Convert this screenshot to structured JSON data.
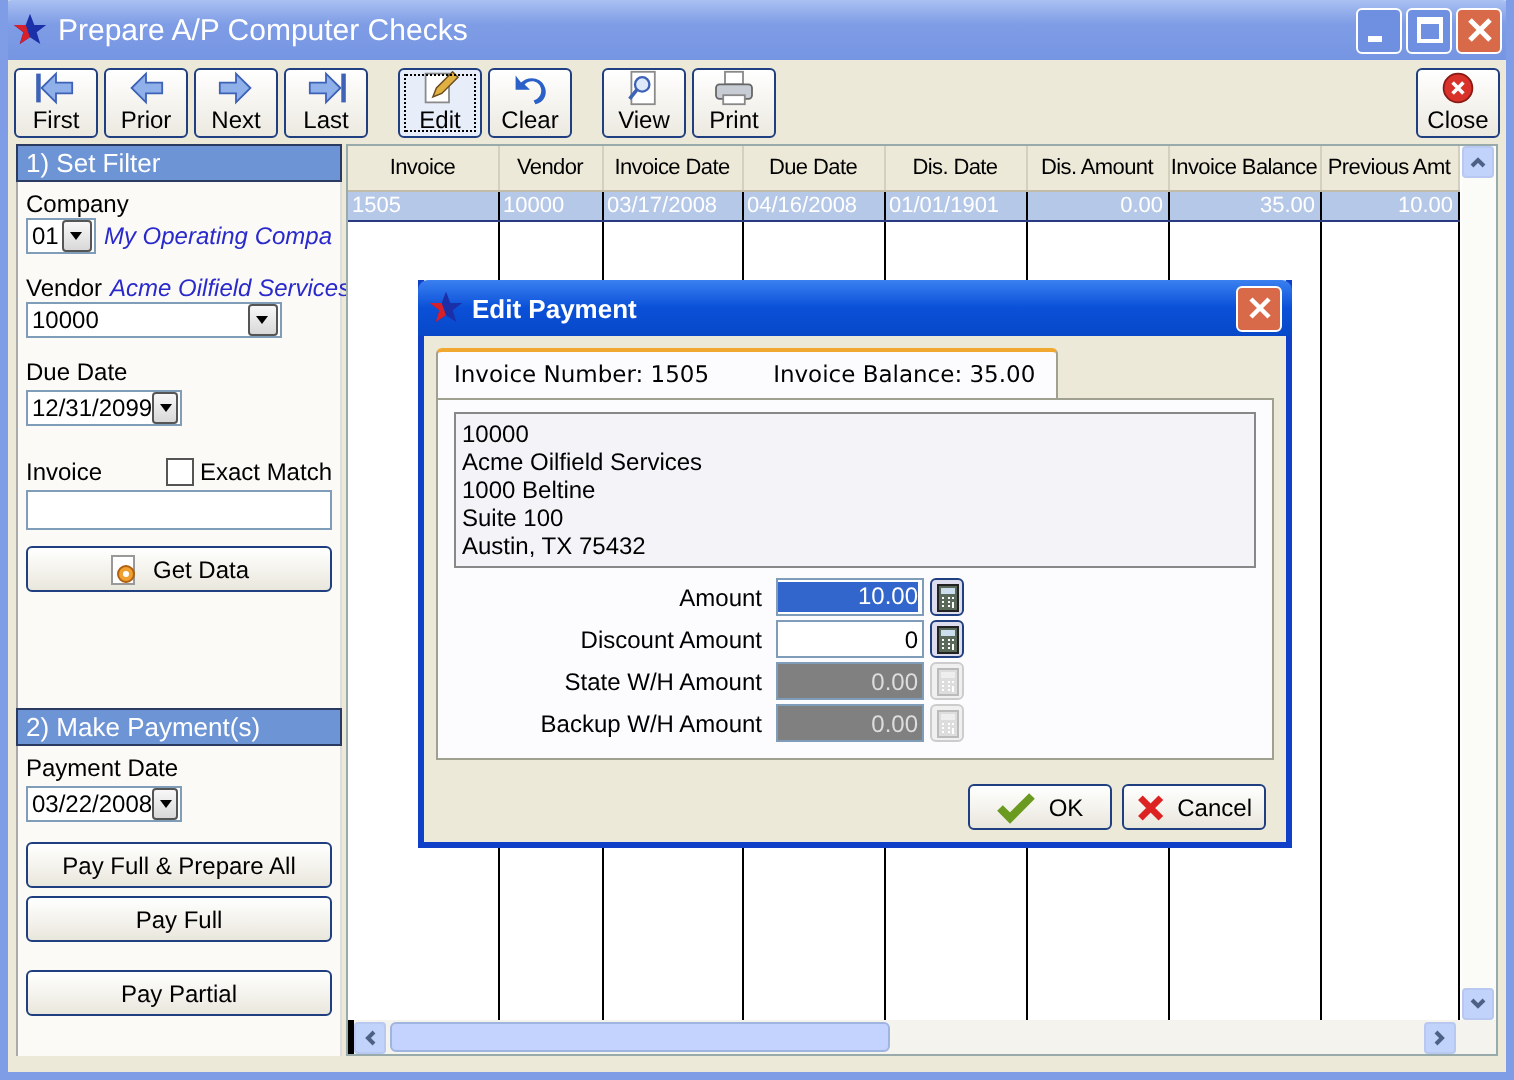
{
  "window": {
    "title": "Prepare A/P Computer Checks"
  },
  "toolbar": {
    "buttons": [
      {
        "label": "First",
        "kind": "first",
        "focused": false
      },
      {
        "label": "Prior",
        "kind": "prior",
        "focused": false
      },
      {
        "label": "Next",
        "kind": "next",
        "focused": false
      },
      {
        "label": "Last",
        "kind": "last",
        "focused": false
      },
      {
        "label": "Edit",
        "kind": "edit",
        "focused": true
      },
      {
        "label": "Clear",
        "kind": "clear",
        "focused": false
      },
      {
        "label": "View",
        "kind": "view",
        "focused": false
      },
      {
        "label": "Print",
        "kind": "print",
        "focused": false
      }
    ],
    "close": {
      "label": "Close"
    }
  },
  "filter": {
    "heading": "1) Set Filter",
    "company_label": "Company",
    "company_value": "01",
    "company_name": "My Operating Compa",
    "vendor_label": "Vendor",
    "vendor_name": "Acme Oilfield Services",
    "vendor_value": "10000",
    "due_date_label": "Due Date",
    "due_date_value": "12/31/2099",
    "invoice_label": "Invoice",
    "exact_match": {
      "label": "Exact Match",
      "checked": false
    },
    "get_data": "Get Data"
  },
  "payment": {
    "heading": "2) Make Payment(s)",
    "date_label": "Payment Date",
    "date_value": "03/22/2008",
    "buttons": [
      "Pay Full & Prepare All",
      "Pay Full",
      "Pay Partial"
    ]
  },
  "grid": {
    "columns": [
      {
        "label": "Invoice"
      },
      {
        "label": "Vendor"
      },
      {
        "label": "Invoice Date"
      },
      {
        "label": "Due Date"
      },
      {
        "label": "Dis. Date"
      },
      {
        "label": "Dis. Amount"
      },
      {
        "label": "Invoice Balance"
      },
      {
        "label": "Previous Amt"
      }
    ],
    "rows": [
      {
        "cells": [
          "1505",
          "10000",
          "03/17/2008",
          "04/16/2008",
          "01/01/1901",
          "0.00",
          "35.00",
          "10.00"
        ],
        "selected": true
      }
    ]
  },
  "dialog": {
    "title": "Edit Payment",
    "tab": {
      "invoice_number": "Invoice Number: 1505",
      "invoice_balance": "Invoice Balance: 35.00"
    },
    "address": [
      "10000",
      "Acme Oilfield Services",
      "1000 Beltine",
      "Suite 100",
      "Austin, TX 75432"
    ],
    "fields": [
      {
        "label": "Amount",
        "value": "10.00",
        "selected": true,
        "disabled": false
      },
      {
        "label": "Discount Amount",
        "value": "0",
        "selected": false,
        "disabled": false
      },
      {
        "label": "State W/H Amount",
        "value": "0.00",
        "selected": false,
        "disabled": true
      },
      {
        "label": "Backup W/H Amount",
        "value": "0.00",
        "selected": false,
        "disabled": true
      }
    ],
    "buttons": [
      {
        "label": "OK",
        "kind": "ok"
      },
      {
        "label": "Cancel",
        "kind": "cancel"
      }
    ]
  }
}
